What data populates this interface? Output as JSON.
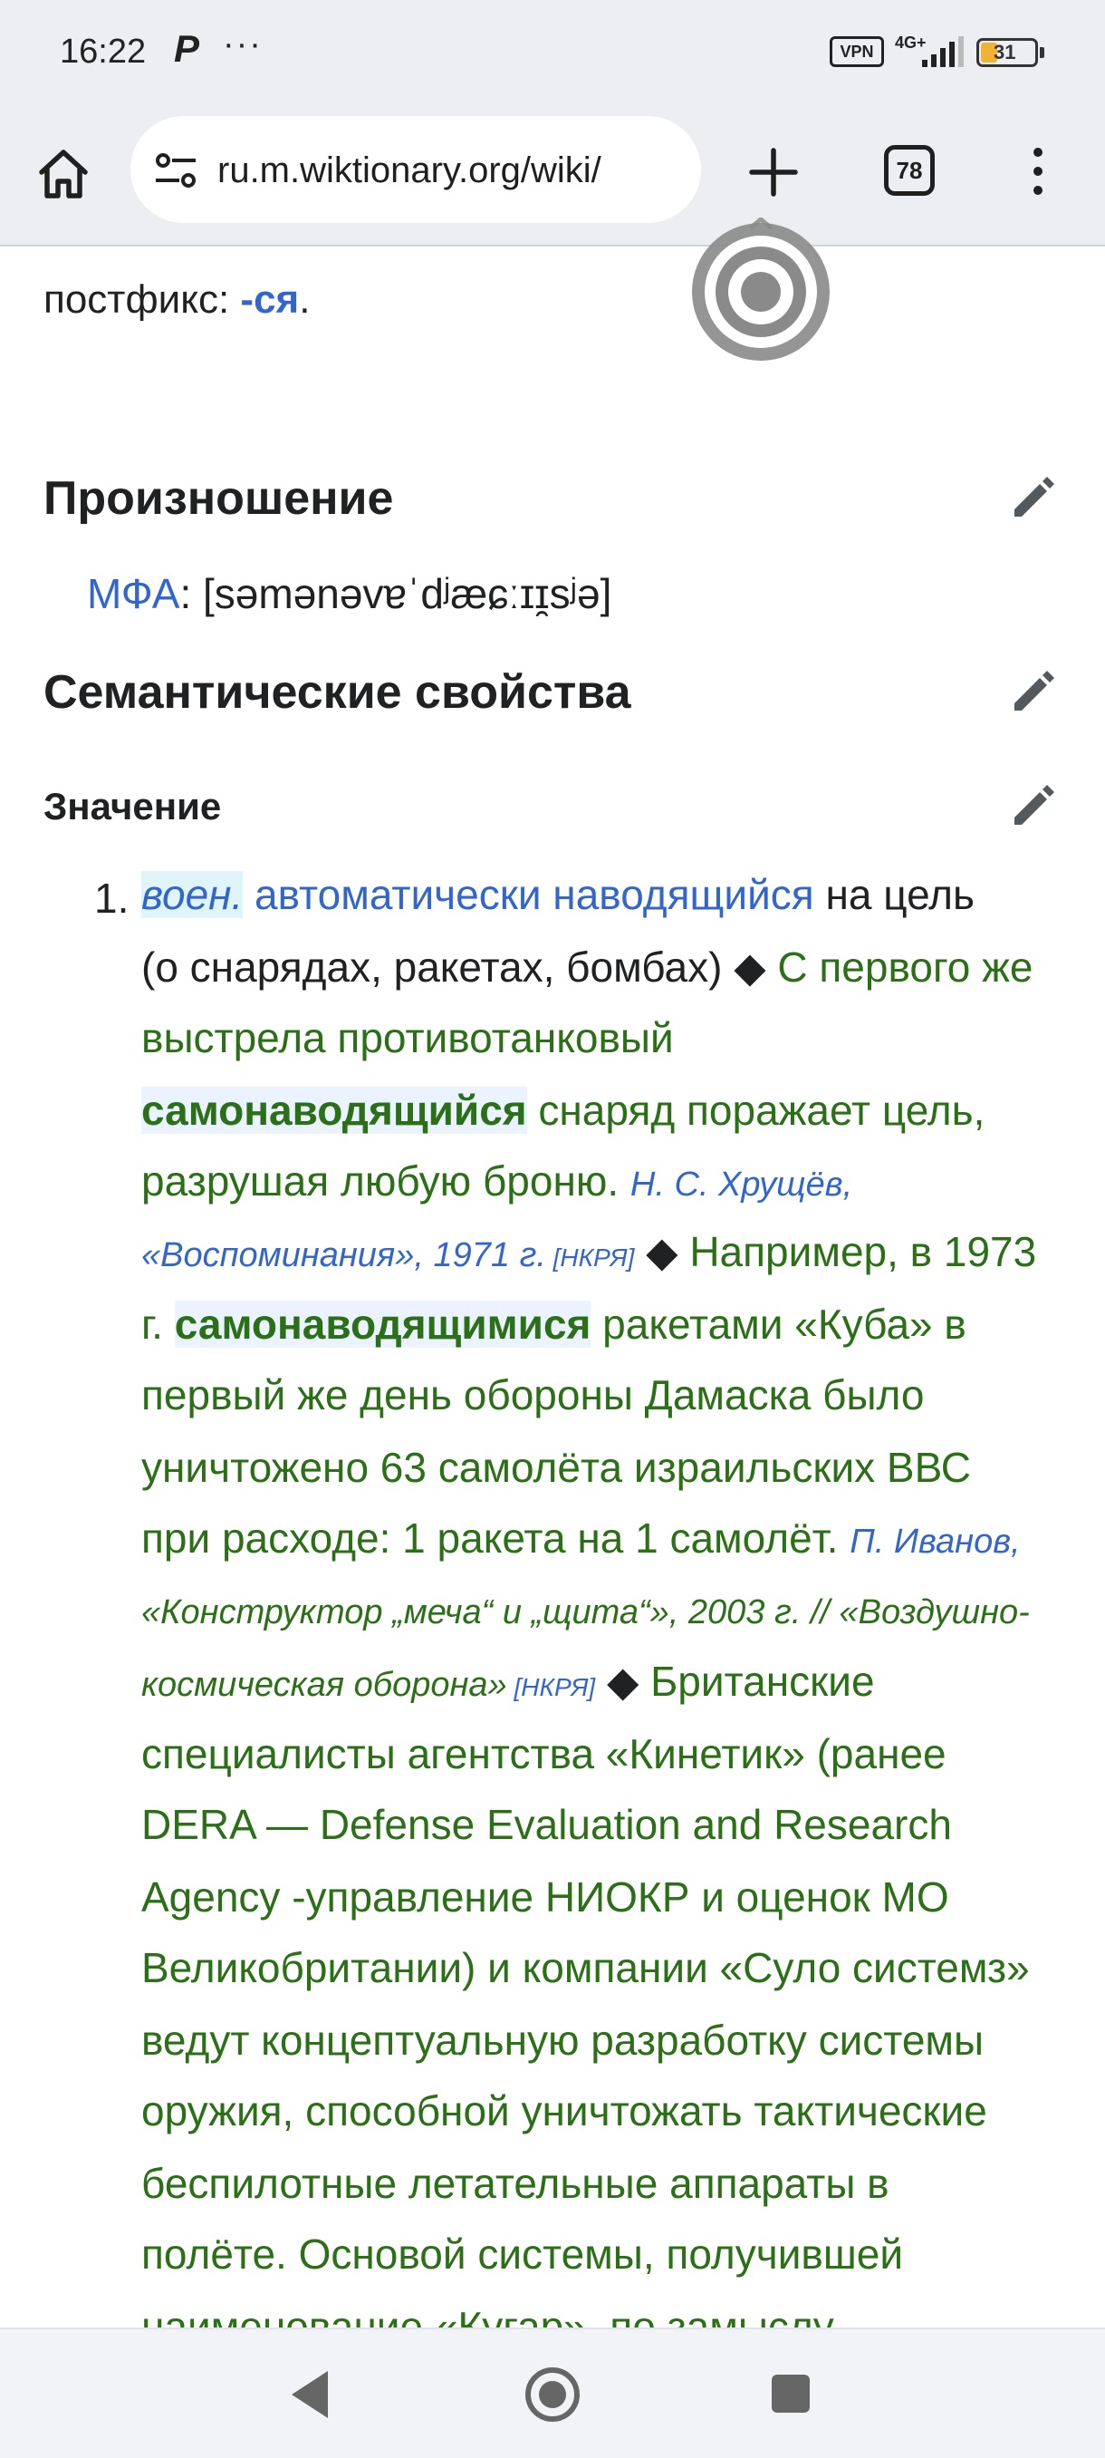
{
  "status_bar": {
    "time": "16:22",
    "p_glyph": "P",
    "dots": "···",
    "vpn": "VPN",
    "network": "4G+",
    "battery": "31"
  },
  "toolbar": {
    "url": "ru.m.wiktionary.org/wiki/",
    "tab_count": "78"
  },
  "article": {
    "postfix_label": "постфикс: ",
    "postfix_value": "-ся",
    "postfix_end": ".",
    "pronunciation_heading": "Произношение",
    "ipa_label": "МФА",
    "ipa_value": ": [səmənəvɐˈdʲæɕːɪɪ̯sʲə]",
    "semantic_heading": "Семантические свойства",
    "meaning_heading": "Значение",
    "item_number": "1.",
    "lines": {
      "l1_tag": "воен.",
      "l1_link": "автоматически наводящийся",
      "l1_rest": " на цель",
      "l2_a": "(о снарядах, ракетах, бомбах) ",
      "l2_diamond": "◆",
      "l2_b": " С первого же",
      "l3": "выстрела противотанковый",
      "l4_bold": "самонаводящийся",
      "l4_rest": " снаряд поражает цель,",
      "l5_a": "разрушая любую броню. ",
      "l5_src": "Н. С. Хрущёв,",
      "l6_src": "«Воспоминания», 1971 г.",
      "l6_nkrya": " [НКРЯ]",
      "l6_diamond": " ◆",
      "l6_rest": " Например, в 1973",
      "l7_a": "г. ",
      "l7_bold": "самонаводящимися",
      "l7_rest": " ракетами «Куба» в",
      "l8": "первый же день обороны Дамаска было",
      "l9": "уничтожено 63 самолёта израильских ВВС",
      "l10_a": "при расходе: 1 ракета на 1 самолёт. ",
      "l10_src": "П. Иванов,",
      "l11_src": "«Конструктор „меча“ и „щита“», 2003 г. // «Воздушно-",
      "l12_src": "космическая оборона»",
      "l12_nkrya": " [НКРЯ]",
      "l12_diamond": " ◆",
      "l12_rest": " Британские",
      "l13": "специалисты агентства «Кинетик» (ранее",
      "l14": "DERA — Defense Evaluation and Research",
      "l15": "Agency -управление НИОКР и оценок МО",
      "l16": "Великобритании) и компании «Суло системз»",
      "l17": "ведут концептуальную разработку системы",
      "l18": "оружия, способной уничтожать тактические",
      "l19": "беспилотные летательные аппараты в",
      "l20": "полёте. Основой системы, получившей",
      "l21": "наименование «Кугар», по замыслу"
    }
  },
  "colors": {
    "link": "#3366cc",
    "example_green": "#2b6f16",
    "chrome_bg": "#eceef1"
  },
  "icons": {
    "home": "home-icon",
    "tune": "tune-icon",
    "new_tab": "plus-icon",
    "menu": "more-vert-icon",
    "edit": "pencil-icon",
    "target": "target-icon",
    "back": "back-triangle-icon",
    "home_nav": "home-circle-icon",
    "recent": "recent-square-icon"
  }
}
